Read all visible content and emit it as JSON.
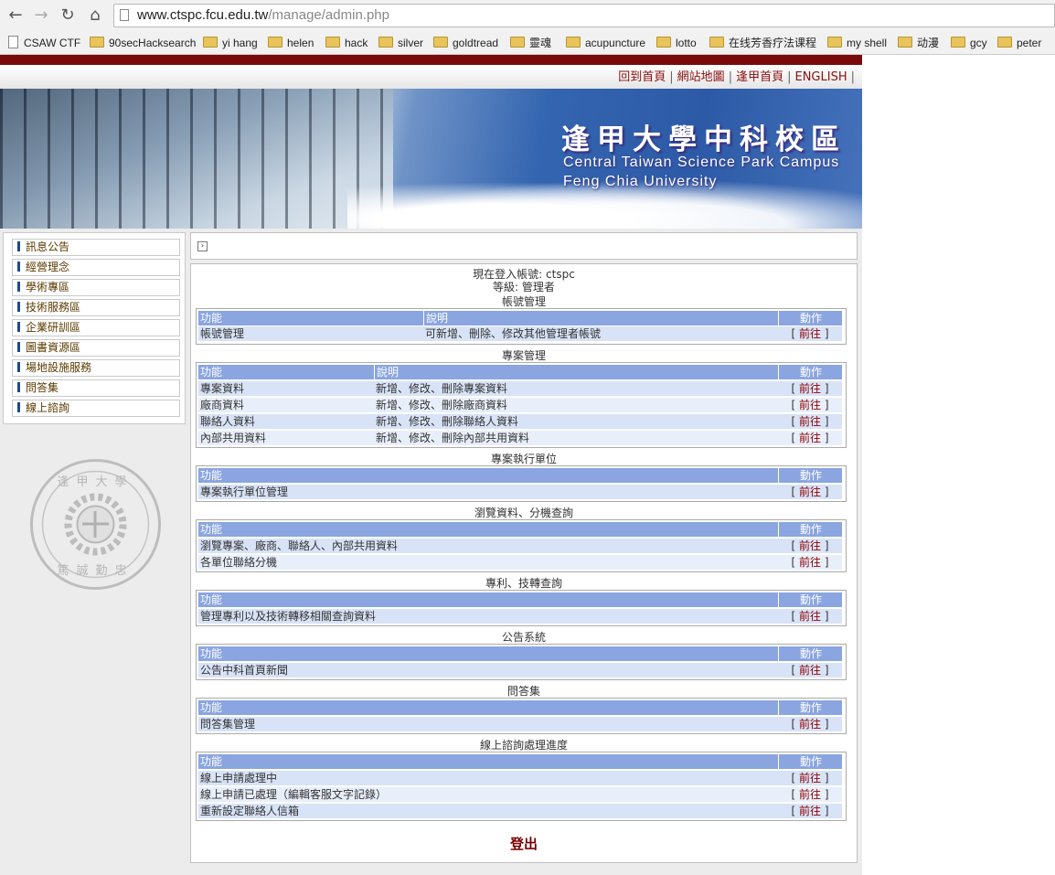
{
  "browser": {
    "url_host": "www.ctspc.fcu.edu.tw",
    "url_path": "/manage/admin.php",
    "bookmarks": [
      "CSAW CTF",
      "90secHacksearch",
      "yi hang",
      "helen",
      "hack",
      "silver",
      "goldtread",
      "靈魂",
      "acupuncture",
      "lotto",
      "在线芳香疗法课程",
      "my shell",
      "动漫",
      "gcy",
      "peter"
    ]
  },
  "topnav": [
    "回到首頁",
    "網站地圖",
    "逢甲首頁",
    "ENGLISH"
  ],
  "banner": {
    "title_zh": "逢甲大學中科校區",
    "title_en1": "Central Taiwan Science Park Campus",
    "title_en2": "Feng Chia University"
  },
  "sidebar": {
    "items": [
      "訊息公告",
      "經營理念",
      "學術專區",
      "技術服務區",
      "企業研訓區",
      "圖書資源區",
      "場地設施服務",
      "問答集",
      "線上諮詢"
    ]
  },
  "login": {
    "account_label": "現在登入帳號:",
    "account_value": "ctspc",
    "level_label": "等級:",
    "level_value": "管理者"
  },
  "headers": {
    "func": "功能",
    "desc": "說明",
    "action": "動作"
  },
  "go_label": "前往",
  "sections": [
    {
      "title": "帳號管理",
      "rows": [
        {
          "func": "帳號管理",
          "desc": "可新增、刪除、修改其他管理者帳號"
        }
      ]
    },
    {
      "title": "專案管理",
      "rows": [
        {
          "func": "專案資料",
          "desc": "新增、修改、刪除專案資料"
        },
        {
          "func": "廠商資料",
          "desc": "新增、修改、刪除廠商資料"
        },
        {
          "func": "聯絡人資料",
          "desc": "新增、修改、刪除聯絡人資料"
        },
        {
          "func": "內部共用資料",
          "desc": "新增、修改、刪除內部共用資料"
        }
      ]
    },
    {
      "title": "專案執行單位",
      "rows": [
        {
          "func": "專案執行單位管理"
        }
      ]
    },
    {
      "title": "瀏覽資料、分機查詢",
      "rows": [
        {
          "func": "瀏覽專案、廠商、聯絡人、內部共用資料"
        },
        {
          "func": "各單位聯絡分機"
        }
      ]
    },
    {
      "title": "專利、技轉查詢",
      "rows": [
        {
          "func": "管理專利以及技術轉移相關查詢資料"
        }
      ]
    },
    {
      "title": "公告系統",
      "rows": [
        {
          "func": "公告中科首頁新聞"
        }
      ]
    },
    {
      "title": "問答集",
      "rows": [
        {
          "func": "問答集管理"
        }
      ]
    },
    {
      "title": "線上諮詢處理進度",
      "rows": [
        {
          "func": "線上申請處理中"
        },
        {
          "func": "線上申請已處理（編輯客服文字記錄）"
        },
        {
          "func": "重新設定聯絡人信箱"
        }
      ]
    }
  ],
  "logout": "登出",
  "seal": {
    "text_top": "逢甲大學",
    "text_bottom": "篤誠勤忠"
  }
}
